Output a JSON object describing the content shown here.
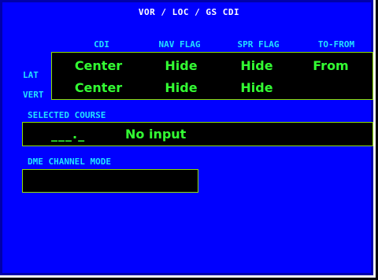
{
  "title": "VOR / LOC / GS CDI",
  "columns": [
    "CDI",
    "NAV FLAG",
    "SPR FLAG",
    "TO-FROM"
  ],
  "rows": [
    {
      "label": "LAT",
      "values": [
        "Center",
        "Hide",
        "Hide",
        "From"
      ]
    },
    {
      "label": "VERT",
      "values": [
        "Center",
        "Hide",
        "Hide",
        ""
      ]
    }
  ],
  "selected_course": {
    "label": "SELECTED COURSE",
    "dashes": "___._",
    "value": "No input"
  },
  "dme": {
    "label": "DME CHANNEL MODE",
    "value": ""
  },
  "colors": {
    "background": "#0000ff",
    "field": "#000000",
    "value_text": "#33ff33",
    "label_text": "#22e0ff",
    "border": "#8fe000"
  }
}
